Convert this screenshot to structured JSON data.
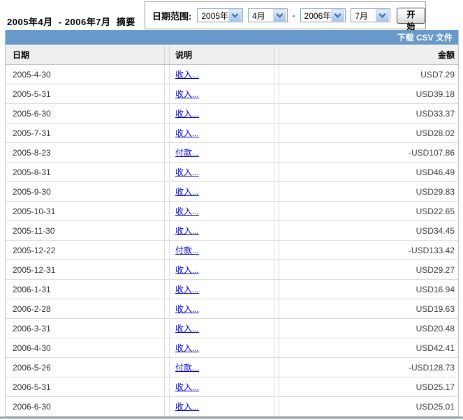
{
  "summary": {
    "title": "2005年4月  - 2006年7月  摘要"
  },
  "date_range": {
    "label": "日期范围:",
    "start_year": "2005年",
    "start_month": "4月",
    "separator": "-",
    "end_year": "2006年",
    "end_month": "7月",
    "start_button_label": "开始"
  },
  "toolbar": {
    "download_csv_label": "下载 CSV 文件"
  },
  "table": {
    "headers": {
      "date": "日期",
      "description": "说明",
      "amount": "金额"
    },
    "rows": [
      {
        "date": "2005-4-30",
        "description": "收入...",
        "amount": "USD7.29"
      },
      {
        "date": "2005-5-31",
        "description": "收入...",
        "amount": "USD39.18"
      },
      {
        "date": "2005-6-30",
        "description": "收入...",
        "amount": "USD33.37"
      },
      {
        "date": "2005-7-31",
        "description": "收入...",
        "amount": "USD28.02"
      },
      {
        "date": "2005-8-23",
        "description": "付款...",
        "amount": "-USD107.86"
      },
      {
        "date": "2005-8-31",
        "description": "收入...",
        "amount": "USD46.49"
      },
      {
        "date": "2005-9-30",
        "description": "收入...",
        "amount": "USD29.83"
      },
      {
        "date": "2005-10-31",
        "description": "收入...",
        "amount": "USD22.65"
      },
      {
        "date": "2005-11-30",
        "description": "收入...",
        "amount": "USD34.45"
      },
      {
        "date": "2005-12-22",
        "description": "付款...",
        "amount": "-USD133.42"
      },
      {
        "date": "2005-12-31",
        "description": "收入...",
        "amount": "USD29.27"
      },
      {
        "date": "2006-1-31",
        "description": "收入...",
        "amount": "USD16.94"
      },
      {
        "date": "2006-2-28",
        "description": "收入...",
        "amount": "USD19.63"
      },
      {
        "date": "2006-3-31",
        "description": "收入...",
        "amount": "USD20.48"
      },
      {
        "date": "2006-4-30",
        "description": "收入...",
        "amount": "USD42.41"
      },
      {
        "date": "2006-5-26",
        "description": "付款...",
        "amount": "-USD128.73"
      },
      {
        "date": "2006-5-31",
        "description": "收入...",
        "amount": "USD25.17"
      },
      {
        "date": "2006-6-30",
        "description": "收入...",
        "amount": "USD25.01"
      }
    ]
  },
  "colors": {
    "toolbar_blue": "#6899c8",
    "table_border_blue": "#abc7e0",
    "link_navy": "#0000cc",
    "header_row_bg": "#efefef",
    "row_border": "#dadada",
    "bottom_strip": "#94a5b5",
    "select_border": "#7f9db9"
  }
}
